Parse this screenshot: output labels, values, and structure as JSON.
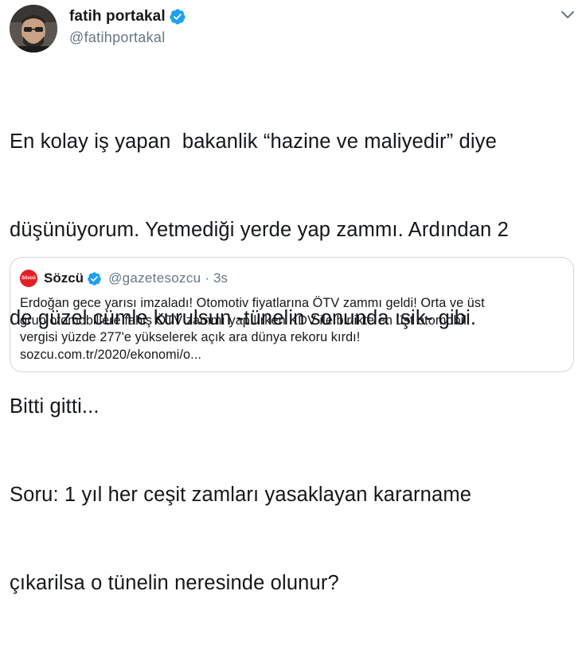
{
  "author": {
    "display_name": "fatih portakal",
    "handle": "@fatihportakal",
    "verified": true
  },
  "tweet": {
    "lines": [
      "En kolay iş yapan  bakanlik “hazine ve maliyedir” diye",
      "düşünüyorum. Yetmediği yerde yap zammı. Ardından 2",
      "de güzel cümle kurulsun -tünelin sonunda ışik- gibi.",
      "Bitti gitti...",
      "Soru: 1 yıl her ceşit zamları yasaklayan kararname",
      "çıkarilsa o tünelin neresinde olunur?"
    ]
  },
  "quoted_tweet": {
    "logo_text": "Sözcü",
    "display_name": "Sözcü",
    "handle": "@gazetesozcu",
    "separator": "·",
    "time": "3s",
    "verified": true,
    "lines": [
      "Erdoğan gece yarısı imzaladı! Otomotiv fiyatlarına ÖTV zammı geldi! Orta ve üst",
      "grup otomobillere fahiş ÖTV zammı yapılırken KDV ile birlikte en üst otomobil",
      "vergisi yüzde 277'e yükselerek açık ara dünya rekoru kırdı!",
      "sozcu.com.tr/2020/ekonomi/o..."
    ]
  },
  "icons": {
    "avatar": "avatar",
    "verified": "verified-badge-icon",
    "menu": "chevron-down-icon"
  },
  "colors": {
    "verified_blue": "#1da1f2",
    "secondary_text": "#657786",
    "primary_text": "#14171a",
    "border": "#ccd6dd",
    "sozcu_red": "#e31e24"
  }
}
